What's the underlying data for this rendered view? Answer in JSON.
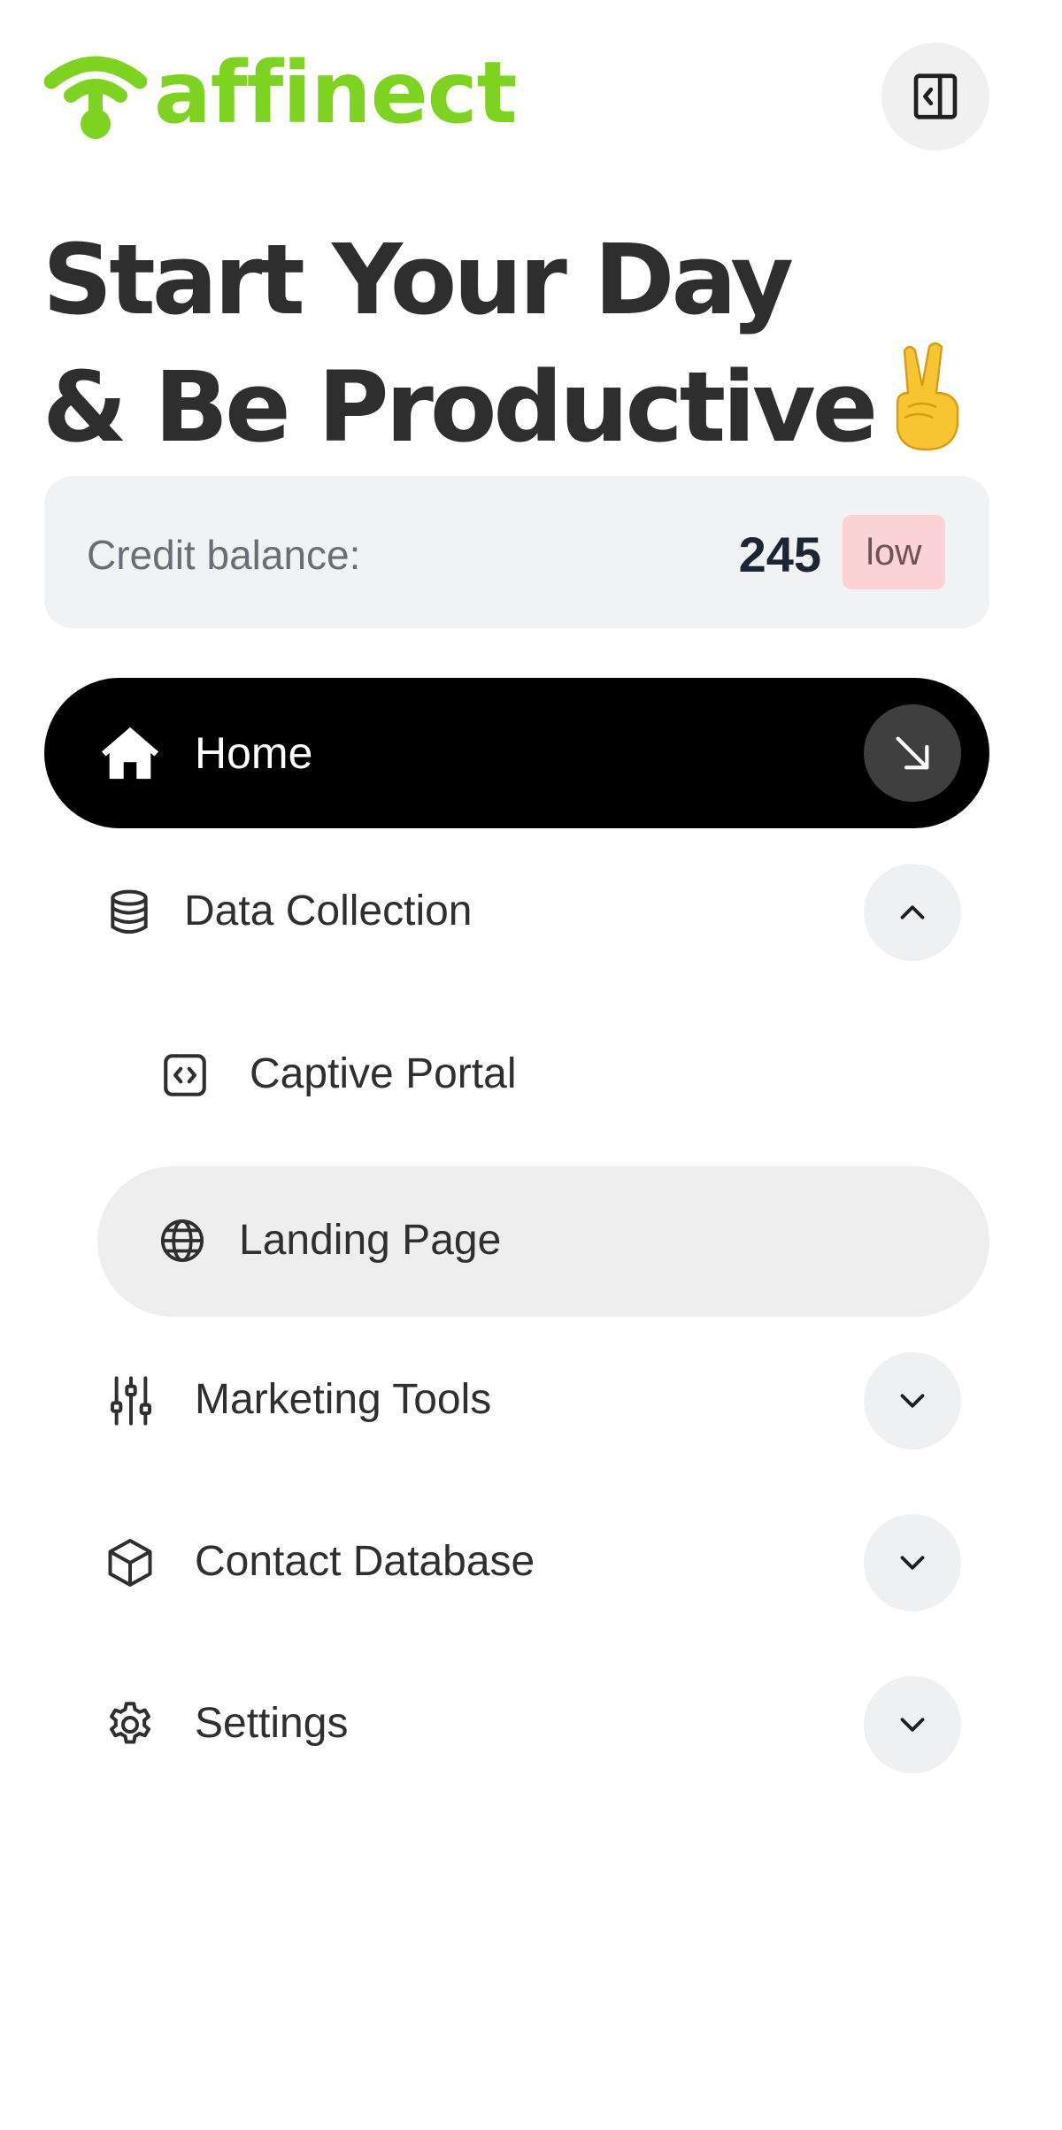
{
  "brand": {
    "name": "affinect",
    "color": "#7ed321"
  },
  "header": {
    "collapse_button_icon": "sidebar-collapse-icon"
  },
  "headline": {
    "line1": "Start Your Day",
    "line2": "& Be Productive",
    "emoji_icon": "victory-hand-icon"
  },
  "credit": {
    "label": "Credit balance:",
    "value": "245",
    "badge": "low",
    "badge_color": "#fcd3d4"
  },
  "nav": {
    "home": {
      "label": "Home",
      "icon": "home-icon",
      "action_icon": "arrow-down-right-icon",
      "active": true
    },
    "data_collection": {
      "label": "Data Collection",
      "icon": "database-icon",
      "expanded": true,
      "toggle_icon": "chevron-up-icon",
      "children": [
        {
          "label": "Captive Portal",
          "icon": "code-icon"
        },
        {
          "label": "Landing Page",
          "icon": "globe-icon",
          "selected": true
        }
      ]
    },
    "marketing_tools": {
      "label": "Marketing Tools",
      "icon": "sliders-icon",
      "toggle_icon": "chevron-down-icon"
    },
    "contact_database": {
      "label": "Contact Database",
      "icon": "cube-icon",
      "toggle_icon": "chevron-down-icon"
    },
    "settings": {
      "label": "Settings",
      "icon": "gear-icon",
      "toggle_icon": "chevron-down-icon"
    }
  }
}
